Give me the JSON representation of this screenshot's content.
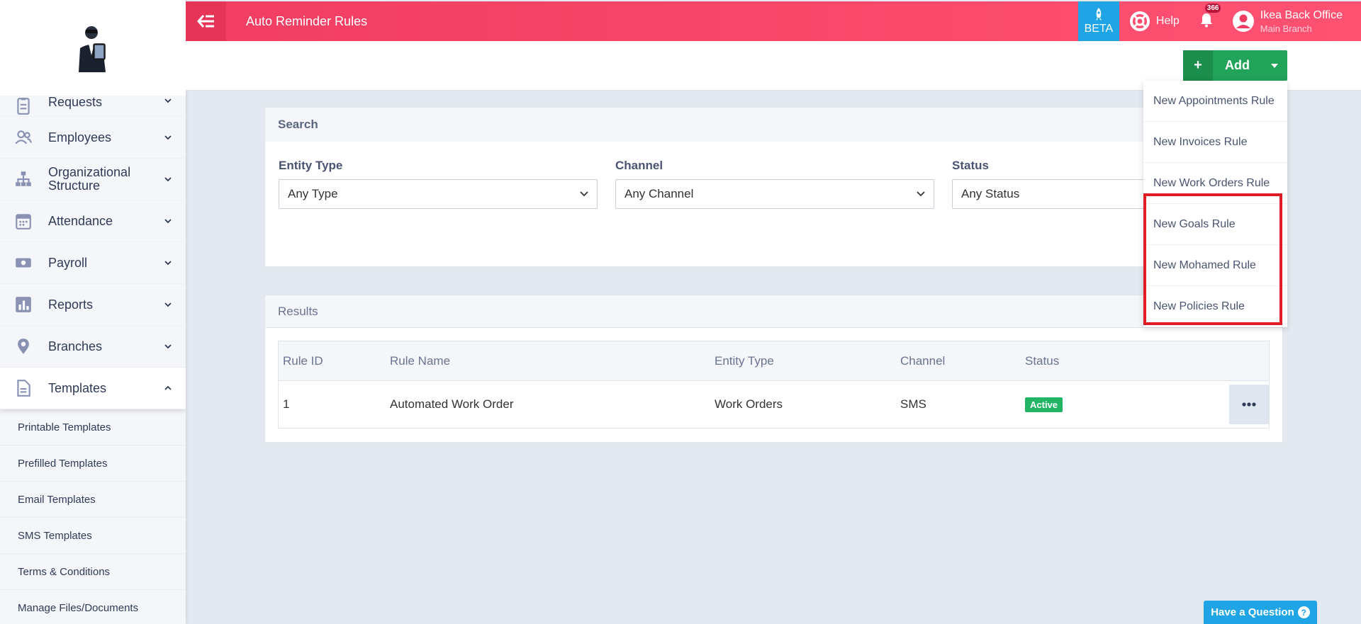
{
  "header": {
    "title": "Auto Reminder Rules",
    "beta_label": "BETA",
    "help_label": "Help",
    "notification_count": "366",
    "user_name": "Ikea Back Office",
    "user_branch": "Main Branch"
  },
  "sidebar": {
    "items": [
      {
        "label": "Requests",
        "icon": "clipboard-icon"
      },
      {
        "label": "Employees",
        "icon": "users-icon"
      },
      {
        "label": "Organizational Structure",
        "icon": "org-chart-icon"
      },
      {
        "label": "Attendance",
        "icon": "calendar-icon"
      },
      {
        "label": "Payroll",
        "icon": "money-icon"
      },
      {
        "label": "Reports",
        "icon": "bar-chart-icon"
      },
      {
        "label": "Branches",
        "icon": "map-pin-icon"
      },
      {
        "label": "Templates",
        "icon": "document-icon"
      }
    ],
    "sub_items": [
      "Printable Templates",
      "Prefilled Templates",
      "Email Templates",
      "SMS Templates",
      "Terms & Conditions",
      "Manage Files/Documents"
    ]
  },
  "toolbar": {
    "add_label": "Add"
  },
  "add_menu": [
    "New Appointments Rule",
    "New Invoices Rule",
    "New Work Orders Rule",
    "New Goals Rule",
    "New Mohamed Rule",
    "New Policies Rule"
  ],
  "search": {
    "title": "Search",
    "entity_type_label": "Entity Type",
    "entity_type_value": "Any Type",
    "channel_label": "Channel",
    "channel_value": "Any Channel",
    "status_label": "Status",
    "status_value": "Any Status"
  },
  "results": {
    "title": "Results",
    "columns": [
      "Rule ID",
      "Rule Name",
      "Entity Type",
      "Channel",
      "Status"
    ],
    "rows": [
      {
        "id": "1",
        "name": "Automated Work Order",
        "entity": "Work Orders",
        "channel": "SMS",
        "status": "Active"
      }
    ]
  },
  "help_widget": {
    "label": "Have a Question",
    "icon": "question-icon"
  },
  "colors": {
    "topbar": "#f13d62",
    "add_button": "#22a35a",
    "beta": "#1fa4e6",
    "highlight": "#e01b24",
    "active_badge": "#22b565"
  }
}
